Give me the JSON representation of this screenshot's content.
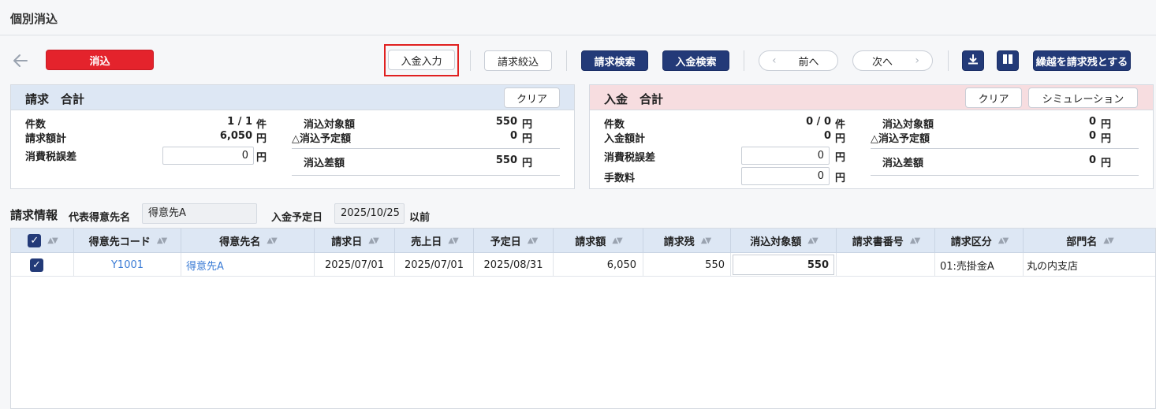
{
  "title": "個別消込",
  "toolbar": {
    "reconcile_label": "消込",
    "payment_input_label": "入金入力",
    "invoice_filter_label": "請求絞込",
    "invoice_search_label": "請求検索",
    "payment_search_label": "入金検索",
    "prev_label": "前へ",
    "next_label": "次へ",
    "carryover_label": "繰越を請求残とする"
  },
  "invoice_summary": {
    "title": "請求　合計",
    "clear_label": "クリア",
    "count_label": "件数",
    "count_value": "1 / 1",
    "count_unit": "件",
    "total_label": "請求額計",
    "total_value": "6,050",
    "total_unit": "円",
    "tax_diff_label": "消費税誤差",
    "tax_diff_value": "0",
    "tax_diff_unit": "円",
    "target_label": "消込対象額",
    "target_value": "550",
    "target_unit": "円",
    "planned_label": "△消込予定額",
    "planned_value": "0",
    "planned_unit": "円",
    "diff_label": "消込差額",
    "diff_value": "550",
    "diff_unit": "円"
  },
  "payment_summary": {
    "title": "入金　合計",
    "clear_label": "クリア",
    "simulation_label": "シミュレーション",
    "count_label": "件数",
    "count_value": "0 / 0",
    "count_unit": "件",
    "total_label": "入金額計",
    "total_value": "0",
    "total_unit": "円",
    "tax_diff_label": "消費税誤差",
    "tax_diff_value": "0",
    "tax_diff_unit": "円",
    "fee_label": "手数料",
    "fee_value": "0",
    "fee_unit": "円",
    "target_label": "消込対象額",
    "target_value": "0",
    "target_unit": "円",
    "planned_label": "△消込予定額",
    "planned_value": "0",
    "planned_unit": "円",
    "diff_label": "消込差額",
    "diff_value": "0",
    "diff_unit": "円"
  },
  "invoice_info": {
    "title": "請求情報",
    "customer_label": "代表得意先名",
    "customer_value": "得意先A",
    "date_label": "入金予定日",
    "date_value": "2025/10/25",
    "date_suffix": "以前"
  },
  "table": {
    "headers": [
      "得意先コード",
      "得意先名",
      "請求日",
      "売上日",
      "予定日",
      "請求額",
      "請求残",
      "消込対象額",
      "請求書番号",
      "請求区分",
      "部門名"
    ],
    "rows": [
      {
        "code": "Y1001",
        "name": "得意先A",
        "invoice_date": "2025/07/01",
        "sales_date": "2025/07/01",
        "due_date": "2025/08/31",
        "amount": "6,050",
        "balance": "550",
        "target": "550",
        "invoice_no": "",
        "category": "01:売掛金A",
        "department": "丸の内支店"
      }
    ]
  },
  "colors": {
    "navy": "#233a78",
    "red": "#e4232c",
    "invoice_header": "#dde7f4",
    "payment_header": "#f7dde0",
    "link": "#3a7bd5"
  }
}
